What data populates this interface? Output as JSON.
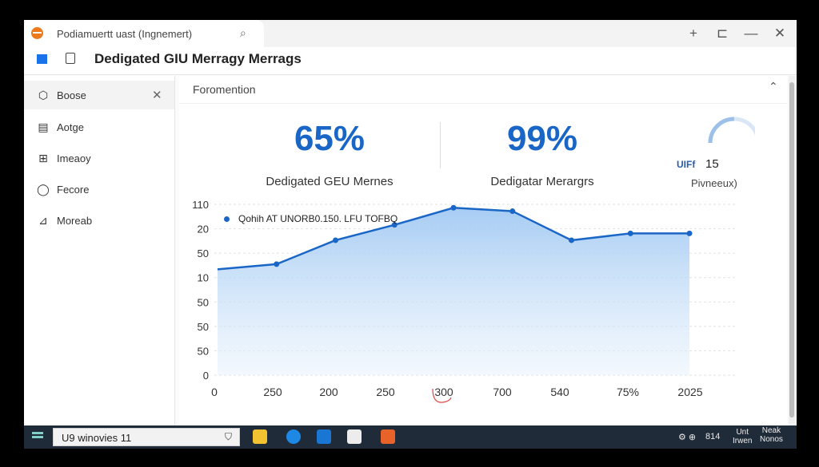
{
  "browser": {
    "tab_title": "Podiamuertt uast (Ingnemert)",
    "window_controls": {
      "new": "+",
      "restore": "⊏",
      "minimize": "—",
      "close": "✕"
    }
  },
  "header": {
    "title": "Dedigated GIU Merragy Merrags"
  },
  "sidebar": {
    "items": [
      {
        "label": "Boose",
        "icon": "cube-icon",
        "active": true
      },
      {
        "label": "Aotge",
        "icon": "card-icon"
      },
      {
        "label": "Imeaoy",
        "icon": "network-icon"
      },
      {
        "label": "Fecore",
        "icon": "circle-icon"
      },
      {
        "label": "Moreab",
        "icon": "chart-icon"
      }
    ]
  },
  "panel": {
    "title": "Foromention",
    "stats": [
      {
        "value": "65%",
        "label": "Dedigated GEU Mernes"
      },
      {
        "value": "99%",
        "label": "Dedigatar Merargrs"
      }
    ],
    "gauge": {
      "label": "UIFf",
      "value": "15",
      "caption": "Pivneeux)"
    }
  },
  "chart_data": {
    "type": "area",
    "series": [
      {
        "name": "Qohih  AT UNORB0.150. LFU TOFBQ",
        "values": [
          0.62,
          0.65,
          0.79,
          0.88,
          0.98,
          0.96,
          0.79,
          0.83,
          0.83
        ]
      }
    ],
    "x_tick_labels": [
      "0",
      "250",
      "200",
      "250",
      "300",
      "700",
      "540",
      "75%",
      "2025"
    ],
    "y_tick_labels": [
      "0",
      "50",
      "50",
      "50",
      "10",
      "50",
      "20",
      "110"
    ],
    "grid": true,
    "color": "#1a66c7"
  },
  "taskbar": {
    "search_text": "U9 winovies 11",
    "tray_text": "814",
    "clock_line1": "Unt",
    "clock_line2": "Irwen",
    "clock2_line1": "Neak",
    "clock2_line2": "Nonos"
  }
}
